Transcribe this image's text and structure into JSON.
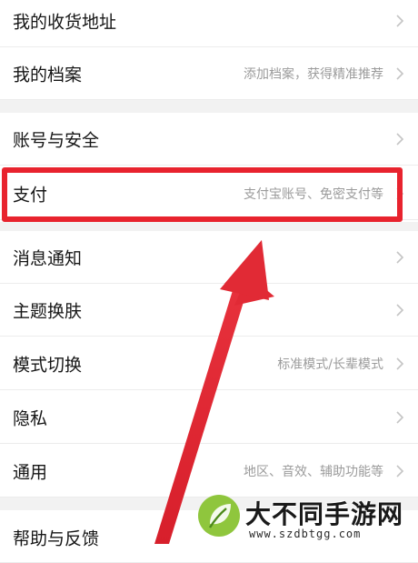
{
  "settings": {
    "group1": [
      {
        "label": "我的收货地址",
        "hint": ""
      },
      {
        "label": "我的档案",
        "hint": "添加档案，获得精准推荐"
      }
    ],
    "group2": [
      {
        "label": "账号与安全",
        "hint": ""
      },
      {
        "label": "支付",
        "hint": "支付宝账号、免密支付等"
      },
      {
        "label": "消息通知",
        "hint": ""
      },
      {
        "label": "主题换肤",
        "hint": ""
      },
      {
        "label": "模式切换",
        "hint": "标准模式/长辈模式"
      },
      {
        "label": "隐私",
        "hint": ""
      },
      {
        "label": "通用",
        "hint": "地区、音效、辅助功能等"
      }
    ],
    "group3": [
      {
        "label": "帮助与反馈",
        "hint": ""
      }
    ]
  },
  "annotation": {
    "highlight_color": "#e8232e",
    "highlighted_item": "支付"
  },
  "watermark": {
    "title": "大不同手游网",
    "url": "www.szdbtgg.com"
  },
  "icons": {
    "chevron": "chevron-right-icon",
    "logo": "leaf-logo-icon"
  }
}
